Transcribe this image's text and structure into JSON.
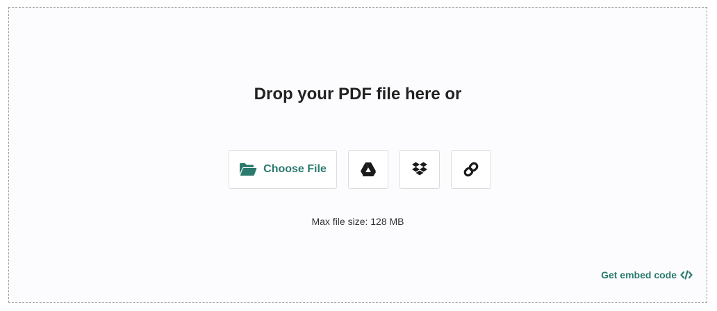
{
  "dropzone": {
    "headline": "Drop your PDF file here or",
    "max_file_size": "Max file size: 128 MB",
    "embed_label": "Get embed code"
  },
  "buttons": {
    "choose_file": "Choose File",
    "choose_file_icon": "folder-open-icon",
    "google_drive_icon": "google-drive-icon",
    "dropbox_icon": "dropbox-icon",
    "link_icon": "link-icon",
    "embed_icon": "code-icon"
  },
  "colors": {
    "accent": "#2a7a6e",
    "text": "#222222",
    "border": "#dcdcdc",
    "background": "#fcfcfe"
  }
}
